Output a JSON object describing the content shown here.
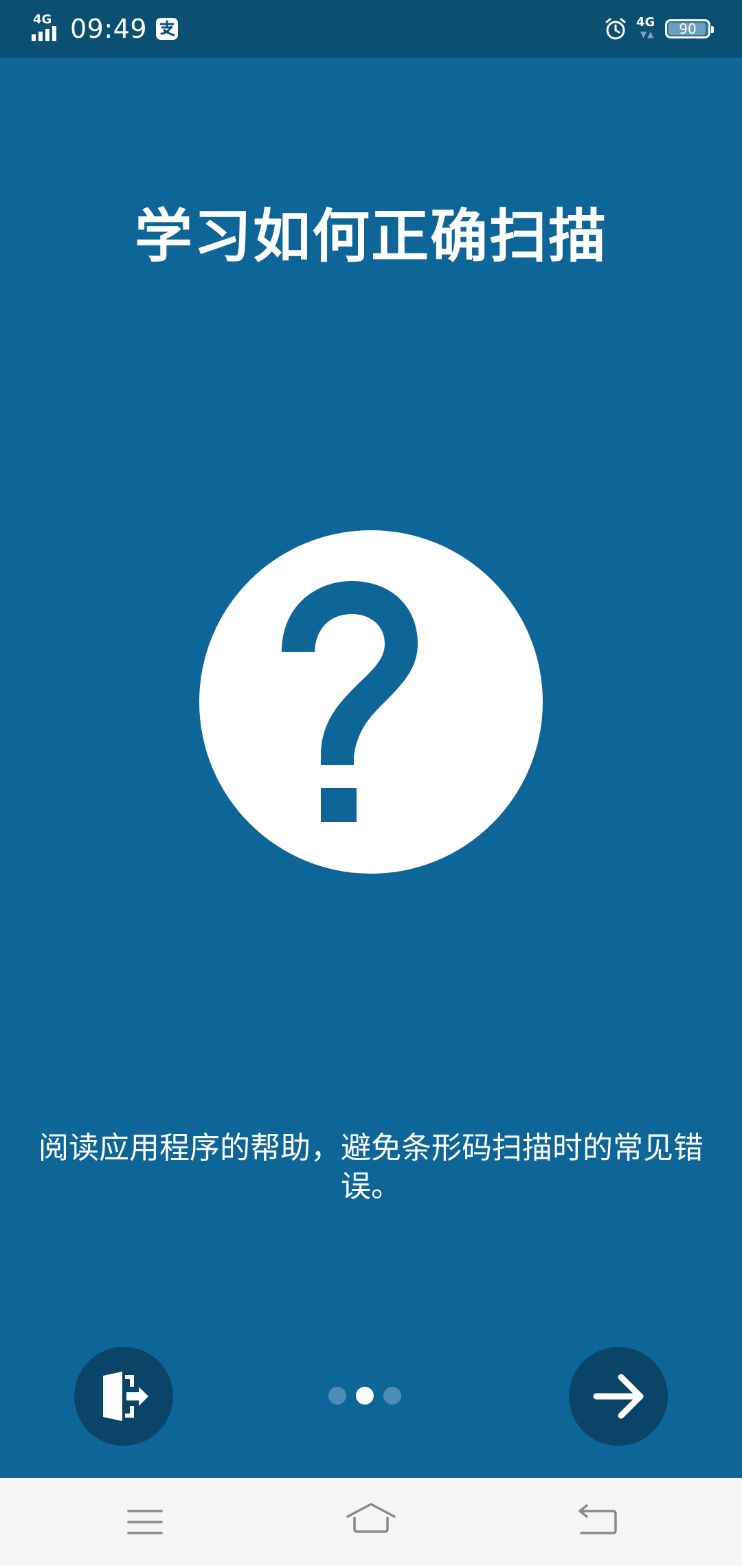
{
  "status_bar": {
    "network_left": "4G",
    "time": "09:49",
    "network_right": "4G",
    "battery_level": "90",
    "icons": [
      "signal-icon",
      "pay-icon",
      "alarm-icon",
      "battery-icon"
    ]
  },
  "onboarding": {
    "title": "学习如何正确扫描",
    "illustration": "help-question-icon",
    "description": "阅读应用程序的帮助，避免条形码扫描时的常见错误。",
    "page_index": 2,
    "page_count": 3,
    "exit_icon": "exit-door-icon",
    "next_icon": "arrow-right-icon"
  },
  "nav_bar": {
    "icons": [
      "menu-icon",
      "home-icon",
      "back-icon"
    ]
  },
  "colors": {
    "background": "#0e6598",
    "status_bar": "#0b4f72",
    "button": "#0a4468",
    "dot_inactive": "#4b8db5",
    "nav_bar": "#f5f5f5"
  }
}
